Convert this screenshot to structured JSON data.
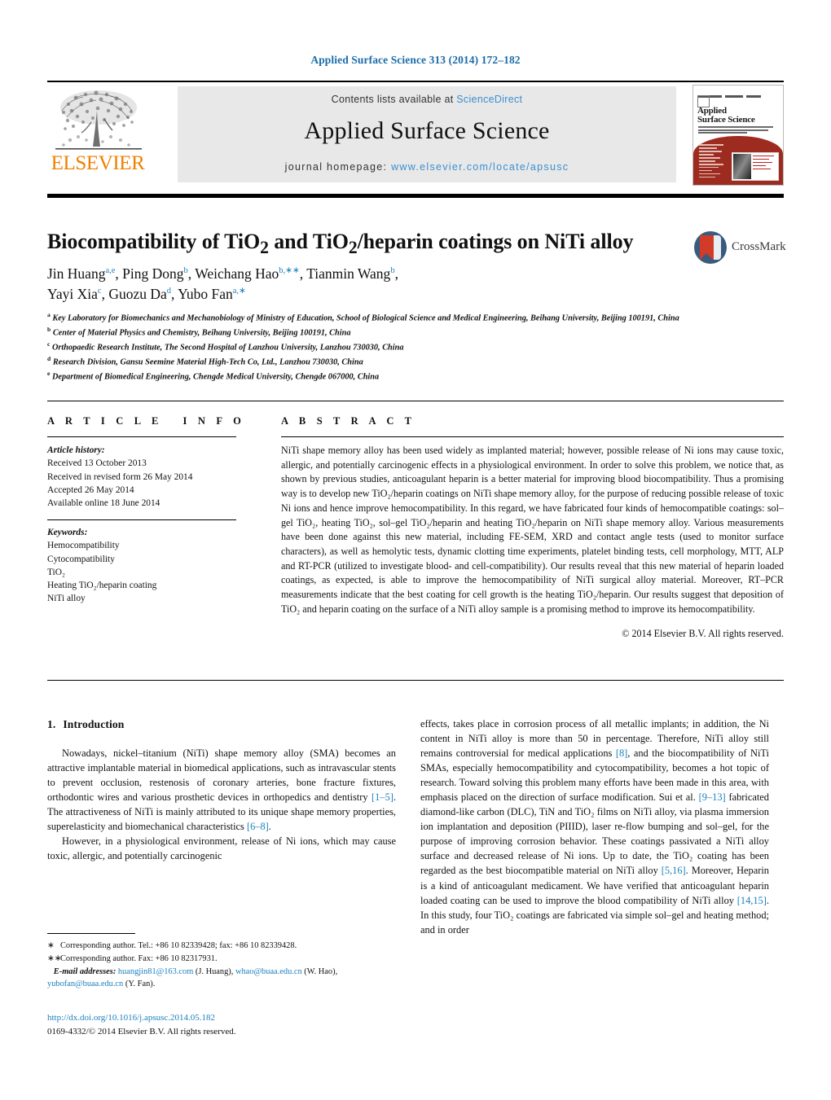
{
  "running_head": "Applied Surface Science 313 (2014) 172–182",
  "banner": {
    "publisher_logo_text": "ELSEVIER",
    "contents_prefix": "Contents lists available at ",
    "contents_link": "ScienceDirect",
    "journal_title": "Applied Surface Science",
    "homepage_prefix": "journal homepage: ",
    "homepage_url": "www.elsevier.com/locate/apsusc",
    "cover_title_line1": "Applied",
    "cover_title_line2": "Surface Science"
  },
  "article": {
    "title": "Biocompatibility of TiO₂ and TiO₂/heparin coatings on NiTi alloy",
    "crossmark_label": "CrossMark",
    "authors_line1": "Jin Huang",
    "authors_line2": "Yayi Xia",
    "authors": [
      {
        "name": "Jin Huang",
        "sup": "a,e"
      },
      {
        "name": "Ping Dong",
        "sup": "b"
      },
      {
        "name": "Weichang Hao",
        "sup": "b,∗∗"
      },
      {
        "name": "Tianmin Wang",
        "sup": "b"
      },
      {
        "name": "Yayi Xia",
        "sup": "c"
      },
      {
        "name": "Guozu Da",
        "sup": "d"
      },
      {
        "name": "Yubo Fan",
        "sup": "a,∗"
      }
    ],
    "affiliations": [
      {
        "mark": "a",
        "text": "Key Laboratory for Biomechanics and Mechanobiology of Ministry of Education, School of Biological Science and Medical Engineering, Beihang University, Beijing 100191, China"
      },
      {
        "mark": "b",
        "text": "Center of Material Physics and Chemistry, Beihang University, Beijing 100191, China"
      },
      {
        "mark": "c",
        "text": "Orthopaedic Research Institute, The Second Hospital of Lanzhou University, Lanzhou 730030, China"
      },
      {
        "mark": "d",
        "text": "Research Division, Gansu Seemine Material High-Tech Co, Ltd., Lanzhou 730030, China"
      },
      {
        "mark": "e",
        "text": "Department of Biomedical Engineering, Chengde Medical University, Chengde 067000, China"
      }
    ]
  },
  "info": {
    "heading": "A R T I C L E   I N F O",
    "history_label": "Article history:",
    "history": [
      "Received 13 October 2013",
      "Received in revised form 26 May 2014",
      "Accepted 26 May 2014",
      "Available online 18 June 2014"
    ],
    "keywords_label": "Keywords:",
    "keywords": [
      "Hemocompatibility",
      "Cytocompatibility",
      "TiO₂",
      "Heating TiO₂/heparin coating",
      "NiTi alloy"
    ]
  },
  "abstract": {
    "heading": "A B S T R A C T",
    "text": "NiTi shape memory alloy has been used widely as implanted material; however, possible release of Ni ions may cause toxic, allergic, and potentially carcinogenic effects in a physiological environment. In order to solve this problem, we notice that, as shown by previous studies, anticoagulant heparin is a better material for improving blood biocompatibility. Thus a promising way is to develop new TiO₂/heparin coatings on NiTi shape memory alloy, for the purpose of reducing possible release of toxic Ni ions and hence improve hemocompatibility. In this regard, we have fabricated four kinds of hemocompatible coatings: sol–gel TiO₂, heating TiO₂, sol–gel TiO₂/heparin and heating TiO₂/heparin on NiTi shape memory alloy. Various measurements have been done against this new material, including FE-SEM, XRD and contact angle tests (used to monitor surface characters), as well as hemolytic tests, dynamic clotting time experiments, platelet binding tests, cell morphology, MTT, ALP and RT-PCR (utilized to investigate blood- and cell-compatibility). Our results reveal that this new material of heparin loaded coatings, as expected, is able to improve the hemocompatibility of NiTi surgical alloy material. Moreover, RT–PCR measurements indicate that the best coating for cell growth is the heating TiO₂/heparin. Our results suggest that deposition of TiO₂ and heparin coating on the surface of a NiTi alloy sample is a promising method to improve its hemocompatibility.",
    "copyright": "© 2014 Elsevier B.V. All rights reserved."
  },
  "body": {
    "section_number": "1.",
    "section_title": "Introduction",
    "left_paragraph_1_a": "Nowadays, nickel–titanium (NiTi) shape memory alloy (SMA) becomes an attractive implantable material in biomedical applications, such as intravascular stents to prevent occlusion, restenosis of coronary arteries, bone fracture fixtures, orthodontic wires and various prosthetic devices in orthopedics and dentistry ",
    "left_ref_1": "[1–5]",
    "left_paragraph_1_b": ". The attractiveness of NiTi is mainly attributed to its unique shape memory properties, superelasticity and biomechanical characteristics ",
    "left_ref_2": "[6–8]",
    "left_paragraph_1_c": ".",
    "left_paragraph_2": "However, in a physiological environment, release of Ni ions, which may cause toxic, allergic, and potentially carcinogenic",
    "right_paragraph_a": "effects, takes place in corrosion process of all metallic implants; in addition, the Ni content in NiTi alloy is more than 50 in percentage. Therefore, NiTi alloy still remains controversial for medical applications ",
    "right_ref_1": "[8]",
    "right_paragraph_b": ", and the biocompatibility of NiTi SMAs, especially hemocompatibility and cytocompatibility, becomes a hot topic of research. Toward solving this problem many efforts have been made in this area, with emphasis placed on the direction of surface modification. Sui et al. ",
    "right_ref_2": "[9–13]",
    "right_paragraph_c": " fabricated diamond-like carbon (DLC), TiN and TiO₂ films on NiTi alloy, via plasma immersion ion implantation and deposition (PIIID), laser re-flow bumping and sol–gel, for the purpose of improving corrosion behavior. These coatings passivated a NiTi alloy surface and decreased release of Ni ions. Up to date, the TiO₂ coating has been regarded as the best biocompatible material on NiTi alloy ",
    "right_ref_3": "[5,16]",
    "right_paragraph_d": ". Moreover, Heparin is a kind of anticoagulant medicament. We have verified that anticoagulant heparin loaded coating can be used to improve the blood compatibility of NiTi alloy ",
    "right_ref_4": "[14,15]",
    "right_paragraph_e": ". In this study, four TiO₂ coatings are fabricated via simple sol–gel and heating method; and in order"
  },
  "footnotes": {
    "corr1": "Corresponding author. Tel.: +86 10 82339428; fax: +86 10 82339428.",
    "corr1_mark": "∗",
    "corr2": "Corresponding author. Fax: +86 10 82317931.",
    "corr2_mark": "∗∗",
    "email_label": "E-mail addresses:",
    "email1": "huangjin81@163.com",
    "email1_owner": "(J. Huang),",
    "email2": "whao@buaa.edu.cn",
    "email2_owner": "(W. Hao),",
    "email3": "yubofan@buaa.edu.cn",
    "email3_owner": "(Y. Fan).",
    "doi": "http://dx.doi.org/10.1016/j.apsusc.2014.05.182",
    "issn_line": "0169-4332/© 2014 Elsevier B.V. All rights reserved."
  },
  "colors": {
    "link_blue": "#1b7fbd",
    "header_blue": "#1b6ca8",
    "elsevier_orange": "#f08000",
    "banner_gray": "#e8e8e8",
    "cover_red": "#9e2b20"
  }
}
